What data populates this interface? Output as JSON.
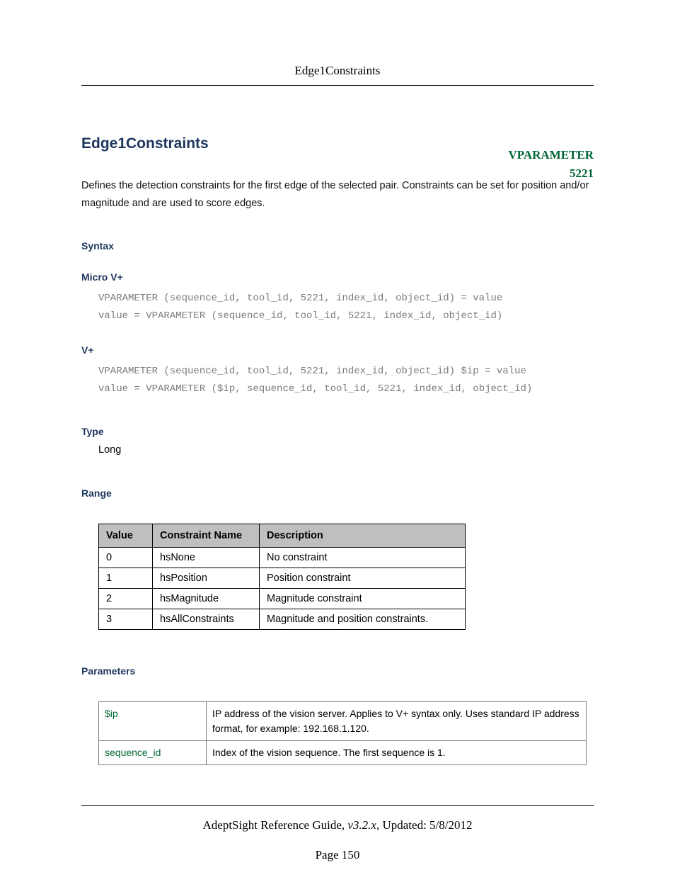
{
  "header": {
    "title": "Edge1Constraints"
  },
  "title": "Edge1Constraints",
  "vparam": {
    "label": "VPARAMETER",
    "number": "5221"
  },
  "description": "Defines the detection constraints for the first edge of the selected pair. Constraints can be set for position and/or magnitude and are used to score edges.",
  "sections": {
    "syntax": "Syntax",
    "micro_v_plus": "Micro V+",
    "v_plus": "V+",
    "type": "Type",
    "range": "Range",
    "parameters": "Parameters"
  },
  "code": {
    "micro1": "VPARAMETER (sequence_id, tool_id, 5221, index_id, object_id) = value",
    "micro2": "value = VPARAMETER (sequence_id, tool_id, 5221, index_id, object_id)",
    "vplus1": "VPARAMETER (sequence_id, tool_id, 5221, index_id, object_id) $ip = value",
    "vplus2": "value = VPARAMETER ($ip, sequence_id, tool_id, 5221, index_id, object_id)"
  },
  "type_value": "Long",
  "range_table": {
    "headers": [
      "Value",
      "Constraint Name",
      "Description"
    ],
    "rows": [
      {
        "value": "0",
        "name": "hsNone",
        "desc": "No constraint"
      },
      {
        "value": "1",
        "name": "hsPosition",
        "desc": "Position constraint"
      },
      {
        "value": "2",
        "name": "hsMagnitude",
        "desc": "Magnitude constraint"
      },
      {
        "value": "3",
        "name": "hsAllConstraints",
        "desc": "Magnitude and position constraints."
      }
    ]
  },
  "param_table": {
    "rows": [
      {
        "name": "$ip",
        "desc": "IP address of the vision server. Applies to V+ syntax only. Uses standard IP address format, for example: 192.168.1.120."
      },
      {
        "name": "sequence_id",
        "desc": "Index of the vision sequence. The first sequence is 1."
      }
    ]
  },
  "footer": {
    "guide": "AdeptSight Reference Guide",
    "version": ", v3.2.x",
    "updated": ", Updated: 5/8/2012",
    "page": "Page 150"
  }
}
